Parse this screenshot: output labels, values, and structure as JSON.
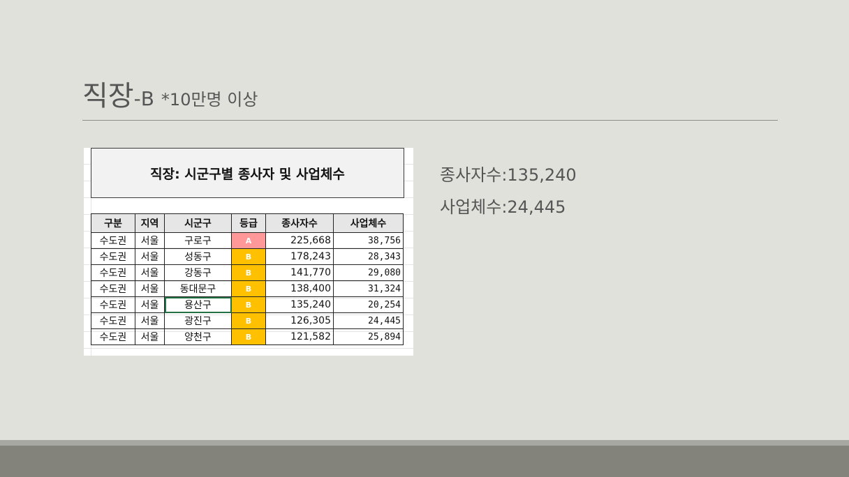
{
  "slide": {
    "title_main": "직장",
    "title_sub": "-B",
    "title_note": "*10만명 이상"
  },
  "sheet": {
    "title": "직장: 시군구별 종사자 및 사업체수",
    "headers": [
      "구분",
      "지역",
      "시군구",
      "등급",
      "종사자수",
      "사업체수"
    ],
    "rows": [
      [
        "수도권",
        "서울",
        "구로구",
        "A",
        "225,668",
        "38,756"
      ],
      [
        "수도권",
        "서울",
        "성동구",
        "B",
        "178,243",
        "28,343"
      ],
      [
        "수도권",
        "서울",
        "강동구",
        "B",
        "141,770",
        "29,080"
      ],
      [
        "수도권",
        "서울",
        "동대문구",
        "B",
        "138,400",
        "31,324"
      ],
      [
        "수도권",
        "서울",
        "용산구",
        "B",
        "135,240",
        "20,254"
      ],
      [
        "수도권",
        "서울",
        "광진구",
        "B",
        "126,305",
        "24,445"
      ],
      [
        "수도권",
        "서울",
        "양천구",
        "B",
        "121,582",
        "25,894"
      ]
    ]
  },
  "stats": {
    "employees": "종사자수:135,240",
    "businesses": "사업체수:24,445"
  },
  "colors": {
    "grade_a": "#ff9999",
    "grade_b": "#ffc000",
    "selection": "#217346",
    "background": "#e1e1dc",
    "footer": "#83837b"
  }
}
